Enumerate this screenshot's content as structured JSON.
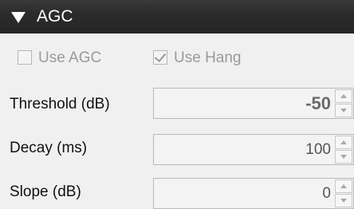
{
  "panel": {
    "title": "AGC",
    "expanded": true,
    "collapse_icon": "triangle-down-icon"
  },
  "checkboxes": {
    "use_agc": {
      "label": "Use AGC",
      "checked": false,
      "enabled": false
    },
    "use_hang": {
      "label": "Use Hang",
      "checked": true,
      "enabled": false
    }
  },
  "fields": {
    "threshold": {
      "label": "Threshold (dB)",
      "value": "-50"
    },
    "decay": {
      "label": "Decay (ms)",
      "value": "100"
    },
    "slope": {
      "label": "Slope (dB)",
      "value": "0"
    }
  },
  "colors": {
    "header_bg": "#2b2b2b",
    "disabled_text": "#9a9a9a",
    "panel_bg": "#f0f0f0"
  }
}
